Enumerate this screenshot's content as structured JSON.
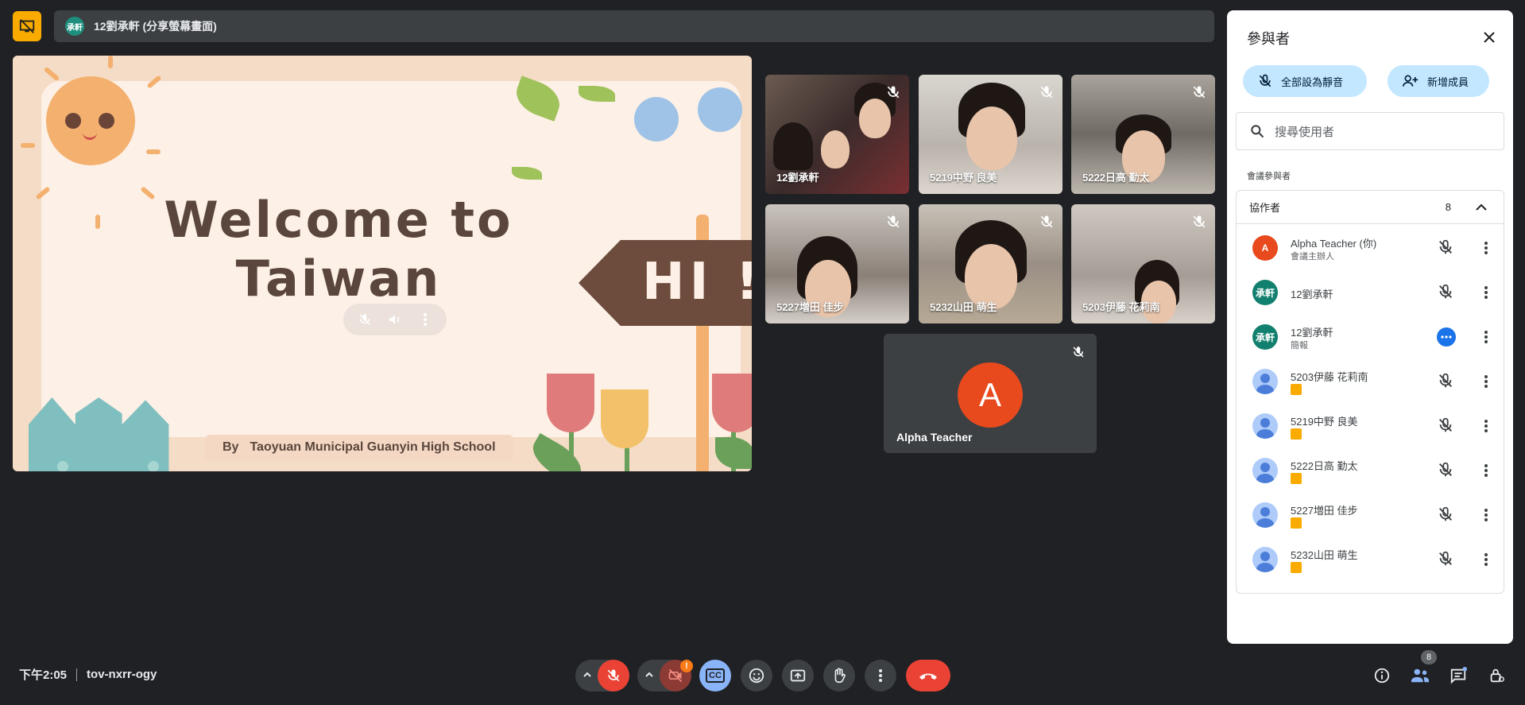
{
  "presenting": {
    "avatar_text": "承軒",
    "title": "12劉承軒 (分享螢幕畫面)"
  },
  "slide": {
    "heading_line1": "Welcome to",
    "heading_line2": "Taiwan",
    "sign_text": "HI !",
    "byline_by": "By",
    "byline_school": "Taoyuan Municipal Guanyin High School"
  },
  "tiles": [
    {
      "name": "12劉承軒"
    },
    {
      "name": "5219中野 良美"
    },
    {
      "name": "5222日高 勤太"
    },
    {
      "name": "5227増田 佳步"
    },
    {
      "name": "5232山田 萌生"
    },
    {
      "name": "5203伊藤 花莉南"
    }
  ],
  "alpha_tile": {
    "initial": "A",
    "name": "Alpha Teacher"
  },
  "panel": {
    "title": "參與者",
    "mute_all": "全部設為靜音",
    "add_member": "新增成員",
    "search_placeholder": "搜尋使用者",
    "section_label": "會議參與者",
    "group_name": "協作者",
    "group_count": "8",
    "participants": [
      {
        "name": "Alpha Teacher (你)",
        "sub": "會議主辦人",
        "avatar": "A"
      },
      {
        "name": "12劉承軒",
        "sub": "",
        "avatar": "承軒"
      },
      {
        "name": "12劉承軒",
        "sub": "簡報",
        "avatar": "承軒"
      },
      {
        "name": "5203伊藤 花莉南",
        "sub": "",
        "avatar": ""
      },
      {
        "name": "5219中野 良美",
        "sub": "",
        "avatar": ""
      },
      {
        "name": "5222日高 勤太",
        "sub": "",
        "avatar": ""
      },
      {
        "name": "5227増田 佳步",
        "sub": "",
        "avatar": ""
      },
      {
        "name": "5232山田 萌生",
        "sub": "",
        "avatar": ""
      }
    ]
  },
  "bottom": {
    "time": "下午2:05",
    "meeting_code": "tov-nxrr-ogy",
    "camera_warning": "!",
    "cc_label": "CC",
    "people_count": "8"
  }
}
